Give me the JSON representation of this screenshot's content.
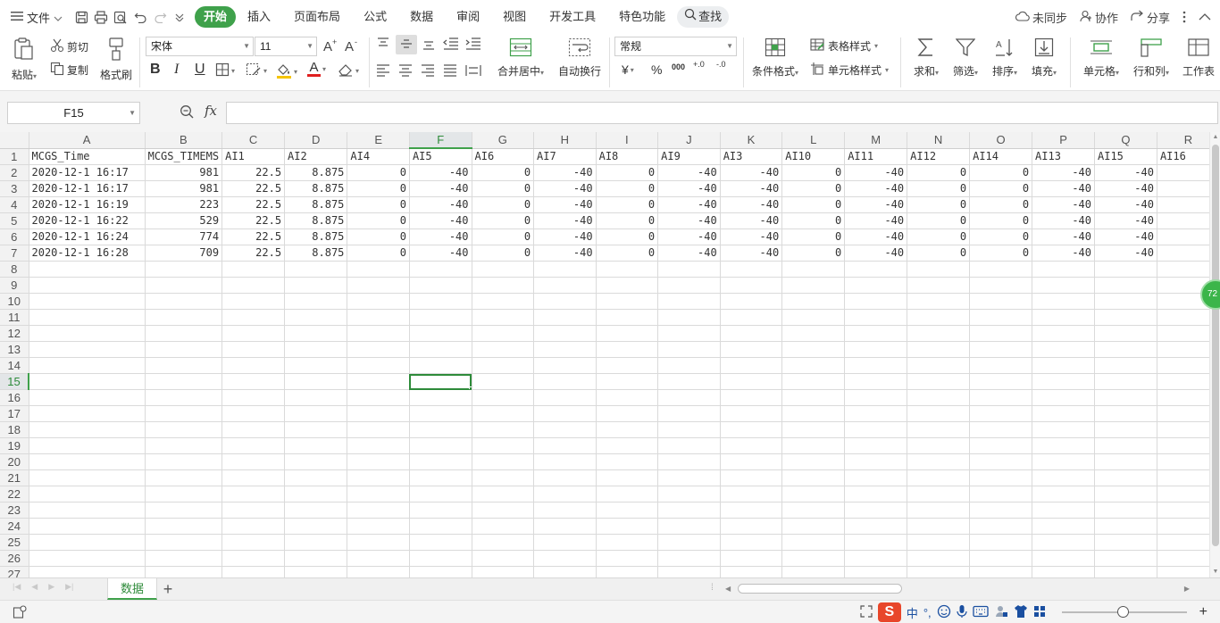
{
  "menubar": {
    "file_label": "文件",
    "tabs": [
      {
        "label": "开始",
        "active": true
      },
      {
        "label": "插入"
      },
      {
        "label": "页面布局"
      },
      {
        "label": "公式"
      },
      {
        "label": "数据"
      },
      {
        "label": "审阅"
      },
      {
        "label": "视图"
      },
      {
        "label": "开发工具"
      },
      {
        "label": "特色功能"
      }
    ],
    "search_label": "查找",
    "sync_label": "未同步",
    "collab_label": "协作",
    "share_label": "分享"
  },
  "ribbon": {
    "paste": "粘贴",
    "cut": "剪切",
    "copy": "复制",
    "format_painter": "格式刷",
    "font_name": "宋体",
    "font_size": "11",
    "number_format": "常规",
    "merge_center": "合并居中",
    "wrap_text": "自动换行",
    "conditional_format": "条件格式",
    "table_style": "表格样式",
    "cell_style": "单元格样式",
    "sum": "求和",
    "filter": "筛选",
    "sort": "排序",
    "fill": "填充",
    "cell": "单元格",
    "row_col": "行和列",
    "worksheet": "工作表",
    "bold": "B",
    "italic": "I",
    "underline": "U",
    "font_color_glyph": "A",
    "currency_glyph": "¥",
    "percent_glyph": "%",
    "thousands_glyph": "000",
    "dec_inc_glyph": "+.0",
    "dec_dec_glyph": "-.0"
  },
  "formula_bar": {
    "name_box": "F15",
    "fx": "fx",
    "formula": ""
  },
  "sheet": {
    "columns": [
      "A",
      "B",
      "C",
      "D",
      "E",
      "F",
      "G",
      "H",
      "I",
      "J",
      "K",
      "L",
      "M",
      "N",
      "O",
      "P",
      "Q",
      "R"
    ],
    "active_column": "F",
    "active_row": 15,
    "selected_cell": "F15",
    "header_row": [
      "MCGS_Time",
      "MCGS_TIMEMS",
      "AI1",
      "AI2",
      "AI4",
      "AI5",
      "AI6",
      "AI7",
      "AI8",
      "AI9",
      "AI3",
      "AI10",
      "AI11",
      "AI12",
      "AI14",
      "AI13",
      "AI15",
      "AI16"
    ],
    "rows": [
      [
        "2020-12-1 16:17",
        "981",
        "22.5",
        "8.875",
        "0",
        "-40",
        "0",
        "-40",
        "0",
        "-40",
        "-40",
        "0",
        "-40",
        "0",
        "0",
        "-40",
        "-40",
        ""
      ],
      [
        "2020-12-1 16:17",
        "981",
        "22.5",
        "8.875",
        "0",
        "-40",
        "0",
        "-40",
        "0",
        "-40",
        "-40",
        "0",
        "-40",
        "0",
        "0",
        "-40",
        "-40",
        ""
      ],
      [
        "2020-12-1 16:19",
        "223",
        "22.5",
        "8.875",
        "0",
        "-40",
        "0",
        "-40",
        "0",
        "-40",
        "-40",
        "0",
        "-40",
        "0",
        "0",
        "-40",
        "-40",
        ""
      ],
      [
        "2020-12-1 16:22",
        "529",
        "22.5",
        "8.875",
        "0",
        "-40",
        "0",
        "-40",
        "0",
        "-40",
        "-40",
        "0",
        "-40",
        "0",
        "0",
        "-40",
        "-40",
        ""
      ],
      [
        "2020-12-1 16:24",
        "774",
        "22.5",
        "8.875",
        "0",
        "-40",
        "0",
        "-40",
        "0",
        "-40",
        "-40",
        "0",
        "-40",
        "0",
        "0",
        "-40",
        "-40",
        ""
      ],
      [
        "2020-12-1 16:28",
        "709",
        "22.5",
        "8.875",
        "0",
        "-40",
        "0",
        "-40",
        "0",
        "-40",
        "-40",
        "0",
        "-40",
        "0",
        "0",
        "-40",
        "-40",
        ""
      ]
    ],
    "total_rows": 27
  },
  "sheet_tabs": {
    "active": "数据"
  },
  "floating_ball_text": "72",
  "status": {
    "ime_lang": "中",
    "ime_punct": "°,"
  },
  "colors": {
    "accent": "#3fa14b",
    "accent_dark": "#2e8b3a"
  }
}
